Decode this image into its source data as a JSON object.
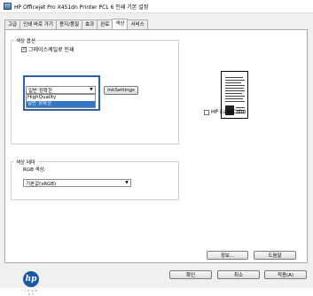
{
  "window": {
    "title": "HP Officejet Pro X451dn Printer PCL 6 인쇄 기본 설정"
  },
  "tabs": [
    {
      "label": "고급",
      "active": false
    },
    {
      "label": "인쇄 바로 가기",
      "active": false
    },
    {
      "label": "용지/품질",
      "active": false
    },
    {
      "label": "효과",
      "active": false
    },
    {
      "label": "완료",
      "active": false
    },
    {
      "label": "색상",
      "active": true
    },
    {
      "label": "서비스",
      "active": false
    }
  ],
  "color_options": {
    "legend": "색상 옵션",
    "grayscale_label": "그레이스케일로 인쇄",
    "grayscale_checked": true,
    "quality_select_value": "일반 정확한",
    "quality_options": [
      "HighQuality",
      "일반 정확한"
    ],
    "quality_selected_index": 1,
    "ink_settings_label": "InkSettings"
  },
  "easycolor": {
    "label": "HP EasyColor",
    "checked": false
  },
  "color_theme": {
    "legend": "색상 테마",
    "rgb_label": "RGB 색상:",
    "rgb_value": "기본값(sRGB)"
  },
  "logo": {
    "tagline": "i n v e n t"
  },
  "panel_buttons": {
    "info_label": "정보...",
    "help_label": "도움말"
  },
  "footer_buttons": {
    "ok_label": "확인",
    "cancel_label": "취소",
    "apply_label": "적용(A)"
  }
}
